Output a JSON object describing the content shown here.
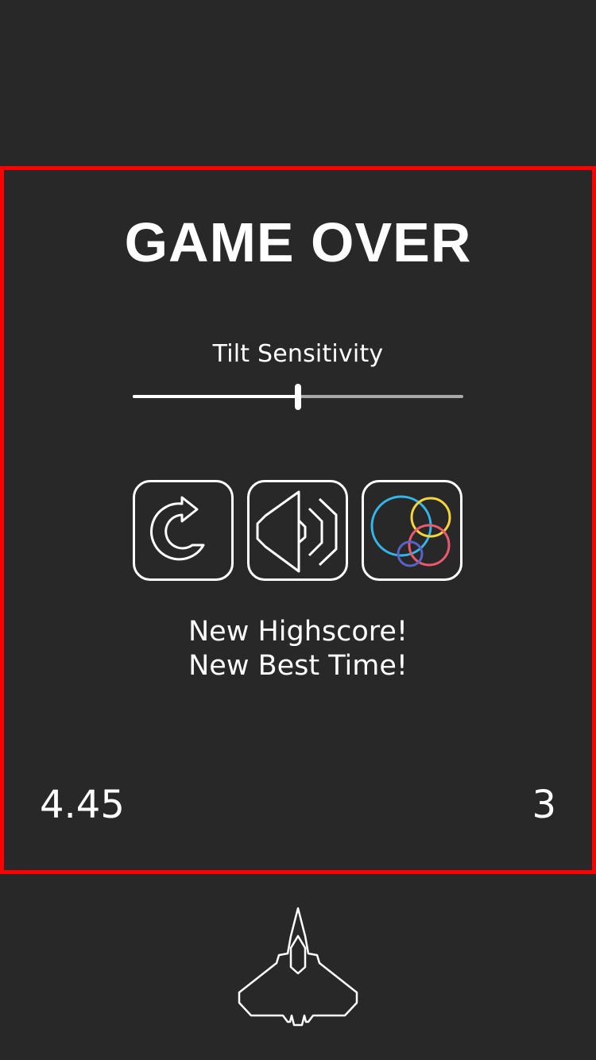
{
  "game_over": {
    "title": "GAME OVER",
    "slider": {
      "label": "Tilt Sensitivity",
      "value_fraction": 0.5
    },
    "buttons": [
      {
        "id": "restart",
        "icon": "restart-icon"
      },
      {
        "id": "sound",
        "icon": "speaker-icon"
      },
      {
        "id": "game-center",
        "icon": "game-center-icon"
      }
    ],
    "messages": {
      "line1": "New Highscore!",
      "line2": "New Best Time!"
    },
    "stats": {
      "time": "4.45",
      "score": "3"
    }
  },
  "colors": {
    "background": "#282828",
    "panel_border": "#ff0000",
    "foreground": "#ffffff",
    "track_inactive": "#a8a8a8",
    "gc_blue": "#35b6ea",
    "gc_yellow": "#f6d43c",
    "gc_red": "#ea5a6e",
    "gc_purple": "#5a63c5"
  },
  "player": {
    "icon": "spaceship-icon"
  }
}
